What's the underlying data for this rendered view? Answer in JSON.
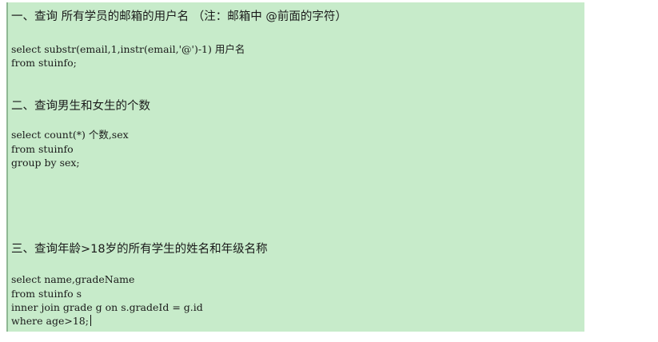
{
  "sections": [
    {
      "heading": "一、查询 所有学员的邮箱的用户名 （注：邮箱中 @前面的字符）",
      "code": [
        "select substr(email,1,instr(email,'@')-1) 用户名",
        "from stuinfo;"
      ]
    },
    {
      "heading": "二、查询男生和女生的个数",
      "code": [
        "select count(*) 个数,sex",
        "from stuinfo",
        "group by sex;"
      ]
    },
    {
      "heading": "三、查询年龄>18岁的所有学生的姓名和年级名称",
      "code": [
        "select name,gradeName",
        "from stuinfo s",
        "inner join grade g on s.gradeId = g.id",
        "where age>18;"
      ]
    }
  ]
}
